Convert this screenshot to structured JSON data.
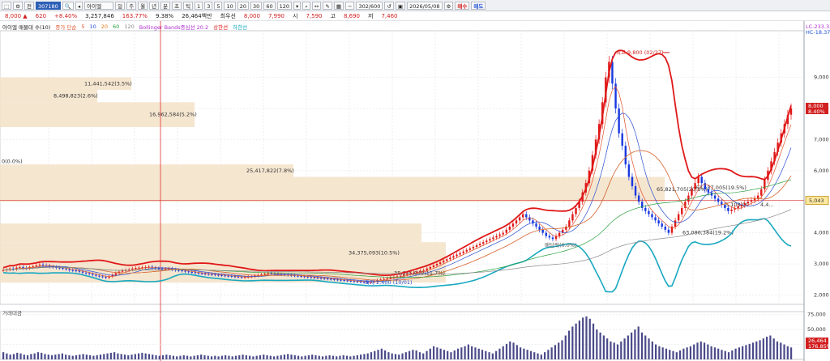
{
  "toolbar": {
    "code": "307180",
    "name": "아이엘",
    "periods": [
      "주",
      "월",
      "년",
      "분",
      "초",
      "틱"
    ],
    "intervals": [
      "1",
      "3",
      "5",
      "10",
      "20",
      "30",
      "60",
      "120"
    ],
    "count": "302/600",
    "date": "2026/05/08",
    "buy": "매수",
    "sell": "매도"
  },
  "quote": {
    "price": "8,000 ▲",
    "change": "620",
    "change_pct": "+8.40%",
    "volume": "3,257,846",
    "vol_ratio": "163.77%",
    "turnover": "9.38%",
    "amount": "26,464백만",
    "best_label": "최우선",
    "ask": "8,000",
    "bid": "7,990",
    "open_label": "시",
    "open": "7,590",
    "high_label": "고",
    "high": "8,690",
    "low_label": "저",
    "low": "7,460"
  },
  "legend": {
    "vp": "아이엘 매물대 수(10)",
    "ma": "종가 단순",
    "ma_periods": [
      "5",
      "10",
      "20",
      "60",
      "120"
    ],
    "bb": "Bollinger Bands중심선 20.2",
    "upper": "상한선",
    "lower": "하한선"
  },
  "colors": {
    "ma5": "#e0502a",
    "ma10": "#2a4fd0",
    "ma20": "#e07a18",
    "ma60": "#2aa040",
    "ma120": "#8a8a8a",
    "bb_mid": "#b030d0",
    "bb_upper": "#e01818",
    "bb_lower": "#18a8c0",
    "up": "#e01818",
    "down": "#1838e0",
    "volume": "#4a4a8a",
    "vp_box": "#f3e2c8"
  },
  "chart_data": {
    "type": "candlestick",
    "y_axis": {
      "min": 1700,
      "max": 10500,
      "ticks": [
        2000,
        3000,
        4000,
        5000,
        6000,
        7000,
        8000,
        9000
      ]
    },
    "y_tick_labels": [
      "2,000",
      "3,000",
      "4,000",
      "5,000",
      "6,000",
      "7,000",
      "8,000",
      "9,000"
    ],
    "top_labels": [
      "LC-233.33",
      "HC-18.37"
    ],
    "price_marker": {
      "value": 8000,
      "text": "8,000",
      "pct": "8.40%"
    },
    "ref_line": {
      "value": 5043,
      "text": "5,043"
    },
    "high_annot": {
      "text": "최고 9,800 (02/27)",
      "value": 9800
    },
    "low_annot": {
      "text": "최저 2,400 (10/01)",
      "value": 2400
    },
    "div_annot": {
      "text": "배당락(0.0%)"
    },
    "volume_profile": [
      {
        "low": 8600,
        "high": 9000,
        "label": "11,441,542(3.5%)"
      },
      {
        "low": 8200,
        "high": 8600,
        "label": "8,498,823(2.6%)"
      },
      {
        "low": 7400,
        "high": 8200,
        "label": "16,962,584(5.2%)"
      },
      {
        "low": 6200,
        "high": 6400,
        "label": "0(0.0%)"
      },
      {
        "low": 5800,
        "high": 6200,
        "label": "25,417,822(7.8%)"
      },
      {
        "low": 5000,
        "high": 5800,
        "label": "65,821,705(20.1%)"
      },
      {
        "low": 5300,
        "high": 5600,
        "label": "63,137,005(19.5%)"
      },
      {
        "low": 4800,
        "high": 5000,
        "label": "5,108,00..."
      },
      {
        "low": 4800,
        "high": 5000,
        "label": "4,4..."
      },
      {
        "low": 3700,
        "high": 4300,
        "label": "63,086,384(19.2%)"
      },
      {
        "low": 3000,
        "high": 3700,
        "label": "34,375,093(10.5%)"
      },
      {
        "low": 2400,
        "high": 3000,
        "label": "38,345,848(11.7%)"
      }
    ],
    "close_series": [
      2800,
      2820,
      2850,
      2830,
      2880,
      2900,
      2870,
      2860,
      2900,
      2920,
      2950,
      2980,
      2960,
      2940,
      2910,
      2900,
      2880,
      2870,
      2850,
      2830,
      2800,
      2790,
      2780,
      2750,
      2720,
      2700,
      2680,
      2650,
      2620,
      2600,
      2580,
      2560,
      2600,
      2650,
      2700,
      2750,
      2780,
      2800,
      2820,
      2850,
      2870,
      2880,
      2890,
      2900,
      2910,
      2880,
      2860,
      2850,
      2830,
      2840,
      2850,
      2820,
      2800,
      2790,
      2780,
      2760,
      2740,
      2730,
      2710,
      2700,
      2690,
      2680,
      2670,
      2660,
      2650,
      2640,
      2630,
      2620,
      2610,
      2600,
      2590,
      2580,
      2570,
      2580,
      2590,
      2600,
      2620,
      2640,
      2660,
      2680,
      2700,
      2690,
      2680,
      2670,
      2660,
      2650,
      2640,
      2630,
      2620,
      2610,
      2600,
      2590,
      2580,
      2570,
      2560,
      2550,
      2540,
      2530,
      2520,
      2510,
      2500,
      2490,
      2480,
      2470,
      2460,
      2450,
      2440,
      2430,
      2420,
      2410,
      2400,
      2420,
      2450,
      2480,
      2500,
      2520,
      2540,
      2560,
      2580,
      2600,
      2620,
      2650,
      2680,
      2700,
      2720,
      2750,
      2780,
      2800,
      2850,
      2900,
      2950,
      3000,
      3050,
      3100,
      3150,
      3200,
      3250,
      3300,
      3350,
      3400,
      3450,
      3500,
      3550,
      3600,
      3650,
      3700,
      3750,
      3800,
      3850,
      3900,
      3950,
      4000,
      4100,
      4200,
      4300,
      4400,
      4500,
      4600,
      4500,
      4400,
      4300,
      4200,
      4100,
      4000,
      3900,
      3850,
      3800,
      3900,
      4000,
      4100,
      4200,
      4400,
      4600,
      4800,
      5000,
      5300,
      5600,
      6000,
      6500,
      7000,
      7500,
      8200,
      9000,
      9500,
      8800,
      8000,
      7200,
      6800,
      6200,
      5800,
      5500,
      5200,
      5000,
      4800,
      4700,
      4600,
      4500,
      4400,
      4300,
      4200,
      4100,
      4000,
      4200,
      4400,
      4600,
      4800,
      5000,
      5200,
      5400,
      5600,
      5800,
      5600,
      5400,
      5300,
      5200,
      5100,
      5000,
      4900,
      4800,
      4700,
      4750,
      4800,
      4850,
      4900,
      4950,
      5000,
      5050,
      5100,
      5200,
      5400,
      5700,
      6000,
      6300,
      6600,
      6900,
      7200,
      7500,
      7800,
      8000
    ],
    "volume_series": [
      12,
      10,
      8,
      9,
      11,
      10,
      8,
      7,
      9,
      10,
      12,
      11,
      9,
      8,
      7,
      8,
      9,
      10,
      8,
      7,
      6,
      7,
      8,
      9,
      8,
      7,
      6,
      7,
      8,
      9,
      10,
      11,
      12,
      10,
      9,
      8,
      7,
      8,
      9,
      10,
      11,
      10,
      9,
      8,
      7,
      6,
      7,
      8,
      7,
      6,
      5,
      6,
      7,
      6,
      5,
      6,
      7,
      8,
      7,
      6,
      5,
      6,
      5,
      6,
      7,
      6,
      5,
      6,
      7,
      8,
      7,
      6,
      5,
      6,
      7,
      8,
      7,
      6,
      5,
      6,
      7,
      8,
      9,
      8,
      7,
      6,
      5,
      6,
      7,
      8,
      7,
      6,
      5,
      6,
      7,
      6,
      5,
      6,
      7,
      6,
      5,
      6,
      7,
      8,
      9,
      10,
      12,
      14,
      16,
      18,
      15,
      12,
      10,
      9,
      8,
      10,
      12,
      14,
      16,
      15,
      12,
      10,
      14,
      18,
      22,
      20,
      18,
      16,
      14,
      12,
      15,
      18,
      20,
      22,
      25,
      22,
      20,
      18,
      16,
      14,
      12,
      10,
      14,
      18,
      22,
      26,
      30,
      28,
      24,
      20,
      18,
      16,
      14,
      12,
      10,
      8,
      12,
      16,
      20,
      24,
      28,
      32,
      40,
      48,
      55,
      60,
      65,
      70,
      72,
      68,
      60,
      50,
      45,
      40,
      35,
      30,
      28,
      25,
      30,
      35,
      40,
      45,
      50,
      55,
      45,
      40,
      35,
      30,
      25,
      22,
      20,
      18,
      16,
      14,
      12,
      15,
      18,
      20,
      22,
      25,
      28,
      30,
      28,
      25,
      22,
      20,
      18,
      16,
      14,
      12,
      15,
      18,
      20,
      22,
      24,
      26,
      28,
      30,
      32,
      35,
      38,
      40,
      35,
      30,
      28,
      25,
      22,
      20
    ],
    "volume_axis": {
      "max": 80000,
      "ticks": [
        25000,
        50000,
        75000
      ],
      "tick_labels": [
        "25,000",
        "50,000",
        "75,000"
      ]
    },
    "volume_last": "26,464",
    "volume_last_sub": "176.85%",
    "volume_title": "거래대금"
  }
}
